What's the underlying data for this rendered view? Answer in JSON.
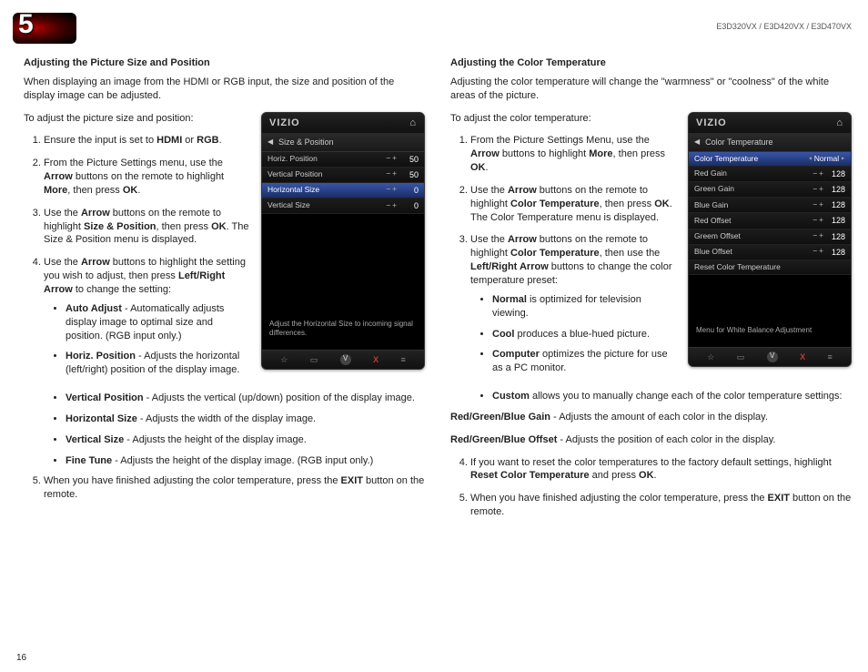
{
  "header": {
    "chapter": "5",
    "models": "E3D320VX / E3D420VX / E3D470VX"
  },
  "page_number": "16",
  "left": {
    "heading": "Adjusting the Picture Size and Position",
    "intro": "When displaying an image from the HDMI or RGB input, the size and position of the display image can be adjusted.",
    "lead": "To adjust the picture size and position:",
    "step1a": "Ensure the input is set to ",
    "step1b_bold": "HDMI",
    "step1c": " or ",
    "step1d_bold": "RGB",
    "step1e": ".",
    "step2a": "From the Picture Settings menu, use the ",
    "step2b_bold": "Arrow",
    "step2c": " buttons on the remote to highlight ",
    "step2d_bold": "More",
    "step2e": ", then press ",
    "step2f_bold": "OK",
    "step2g": ".",
    "step3a": "Use the ",
    "step3b_bold": "Arrow",
    "step3c": " buttons on the remote to highlight ",
    "step3d_bold": "Size & Position",
    "step3e": ", then press ",
    "step3f_bold": "OK",
    "step3g": ". The Size & Position menu is displayed.",
    "step4a": "Use the ",
    "step4b_bold": "Arrow",
    "step4c": " buttons to highlight the setting you wish to adjust, then press ",
    "step4d_bold": "Left/Right Arrow",
    "step4e": " to change the setting:",
    "b1a_bold": "Auto Adjust",
    "b1b": " - Automatically adjusts display image to optimal size and position. (RGB input only.)",
    "b2a_bold": "Horiz. Position",
    "b2b": " - Adjusts the horizontal (left/right) position of the display image.",
    "b3a_bold": "Vertical Position",
    "b3b": " - Adjusts the vertical (up/down) position of the display image.",
    "b4a_bold": "Horizontal Size",
    "b4b": " - Adjusts the width of the display image.",
    "b5a_bold": "Vertical Size",
    "b5b": " - Adjusts the height of the display image.",
    "b6a_bold": "Fine Tune",
    "b6b": " - Adjusts the height of the display image. (RGB input only.)",
    "step5a": "When you have finished adjusting the color temperature, press the ",
    "step5b_bold": "EXIT",
    "step5c": " button on the remote."
  },
  "right": {
    "heading": "Adjusting the Color Temperature",
    "intro": "Adjusting the color temperature will change the \"warmness\" or \"coolness\" of the white areas of the picture.",
    "lead": "To adjust the color temperature:",
    "step1a": "From the Picture Settings Menu, use the ",
    "step1b_bold": "Arrow",
    "step1c": " buttons to highlight ",
    "step1d_bold": "More",
    "step1e": ", then press ",
    "step1f_bold": "OK",
    "step1g": ".",
    "step2a": "Use the ",
    "step2b_bold": "Arrow",
    "step2c": " buttons on the remote to highlight ",
    "step2d_bold": "Color Temperature",
    "step2e": ", then press ",
    "step2f_bold": "OK",
    "step2g": ". The Color Temperature menu is displayed.",
    "step3a": "Use the ",
    "step3b_bold": "Arrow",
    "step3c": " buttons on the remote to highlight ",
    "step3d_bold": "Color Temperature",
    "step3e": ", then use the ",
    "step3f_bold": "Left/Right Arrow",
    "step3g": " buttons to change the color temperature preset:",
    "b1a_bold": "Normal",
    "b1b": " is optimized for television viewing.",
    "b2a_bold": "Cool",
    "b2b": " produces a blue-hued picture.",
    "b3a_bold": "Computer",
    "b3b": " optimizes the picture for use as a PC monitor.",
    "b4a_bold": "Custom",
    "b4b": " allows you to manually change each of the color temperature settings:",
    "sub1a_bold": "Red/Green/Blue Gain",
    "sub1b": " - Adjusts the amount of each color in the display.",
    "sub2a_bold": "Red/Green/Blue Offset",
    "sub2b": " - Adjusts the position of each color in the display.",
    "step4a": "If you want to reset the color temperatures to the factory default settings, highlight ",
    "step4b_bold": "Reset Color Temperature",
    "step4c": " and press ",
    "step4d_bold": "OK",
    "step4e": ".",
    "step5a": "When you have finished adjusting the color temperature, press the ",
    "step5b_bold": "EXIT",
    "step5c": " button on the remote."
  },
  "osd1": {
    "brand": "VIZIO",
    "title": "Size & Position",
    "rows": [
      {
        "label": "Horiz. Position",
        "value": "50"
      },
      {
        "label": "Vertical Position",
        "value": "50"
      },
      {
        "label": "Horizontal Size",
        "value": "0",
        "highlight": true
      },
      {
        "label": "Vertical Size",
        "value": "0"
      }
    ],
    "help": "Adjust the Horizontal Size to incoming signal differences."
  },
  "osd2": {
    "brand": "VIZIO",
    "title": "Color Temperature",
    "selected_label": "Color Temperature",
    "selected_value": "Normal",
    "rows": [
      {
        "label": "Red Gain",
        "value": "128"
      },
      {
        "label": "Green Gain",
        "value": "128"
      },
      {
        "label": "Blue Gain",
        "value": "128"
      },
      {
        "label": "Red Offset",
        "value": "128"
      },
      {
        "label": "Greem Offset",
        "value": "128"
      },
      {
        "label": "Blue Offset",
        "value": "128"
      }
    ],
    "reset": "Reset Color Temperature",
    "help": "Menu for White Balance Adjustment"
  }
}
